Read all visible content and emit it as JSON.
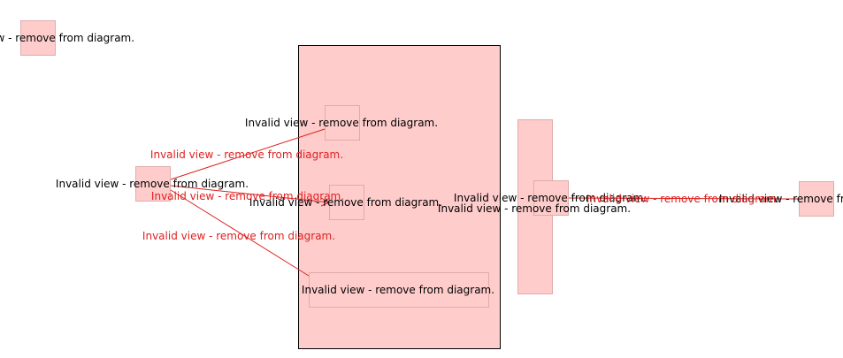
{
  "colors": {
    "node_fill": "#ffcccc",
    "node_border": "#e0aaaa",
    "frame_border": "#000000",
    "edge": "#e02020",
    "edge_label": "#e02020",
    "node_label": "#000000"
  },
  "nodes": {
    "topleft": "Invalid view - remove from diagram.",
    "left": "Invalid view - remove from diagram.",
    "inner_top": "Invalid view - remove from diagram.",
    "inner_mid": "Invalid view - remove from diagram.",
    "inner_bottom": "Invalid view - remove from diagram.",
    "tall_column": "Invalid view - remove from diagram.",
    "column_child": "Invalid view - remove from diagram.",
    "right": "Invalid view - remove from diagram."
  },
  "edges": {
    "left_to_inner_top": "Invalid view - remove from diagram.",
    "left_to_inner_mid": "Invalid view - remove from diagram.",
    "left_to_inner_bottom": "Invalid view - remove from diagram.",
    "column_to_right": "Invalid view - remove from diagram."
  }
}
